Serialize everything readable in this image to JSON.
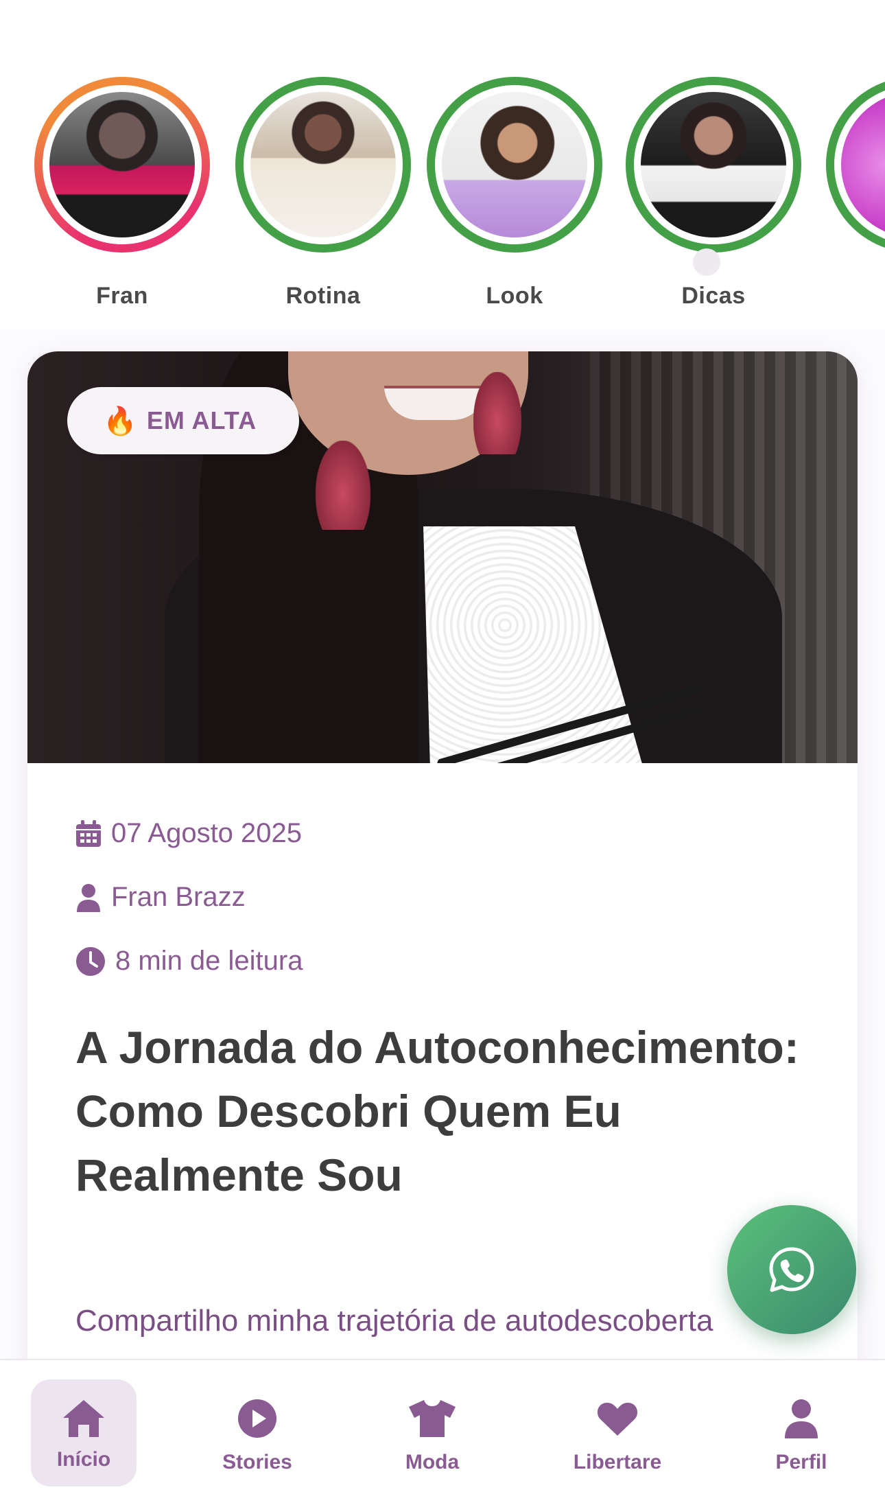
{
  "stories": [
    {
      "label": "Fran",
      "ring": "gradient"
    },
    {
      "label": "Rotina",
      "ring": "green"
    },
    {
      "label": "Look",
      "ring": "green"
    },
    {
      "label": "Dicas",
      "ring": "green"
    }
  ],
  "post": {
    "badge": {
      "emoji": "🔥",
      "text": "EM ALTA"
    },
    "date": "07 Agosto 2025",
    "author": "Fran Brazz",
    "read_time": "8 min de leitura",
    "title": "A Jornada do Autoconhecimento: Como Descobri Quem Eu Realmente Sou",
    "excerpt": "Compartilho minha trajetória de autodescoberta"
  },
  "bottom_nav": {
    "items": [
      {
        "label": "Início",
        "icon": "home-icon",
        "active": true
      },
      {
        "label": "Stories",
        "icon": "play-icon",
        "active": false
      },
      {
        "label": "Moda",
        "icon": "shirt-icon",
        "active": false
      },
      {
        "label": "Libertare",
        "icon": "heart-icon",
        "active": false
      },
      {
        "label": "Perfil",
        "icon": "user-icon",
        "active": false
      }
    ]
  },
  "colors": {
    "accent": "#8a5a92",
    "story_ring_green": "#43a047",
    "whatsapp": "#4caf72",
    "title_text": "#3d3d3d"
  }
}
